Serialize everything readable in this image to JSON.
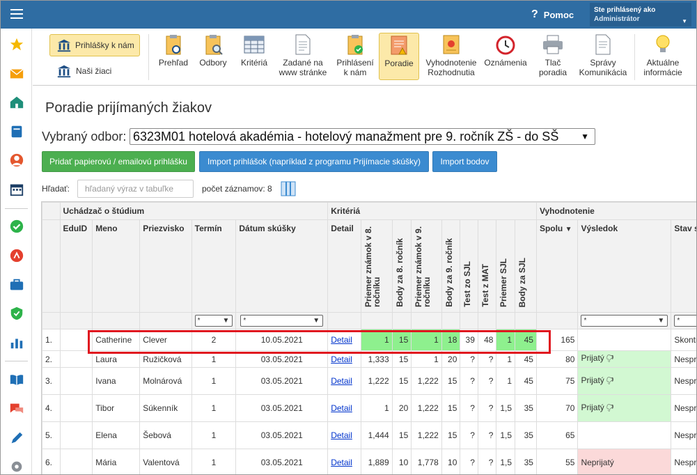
{
  "topbar": {
    "help_label": "Pomoc",
    "user_line1": "Ste prihlásený ako",
    "user_line2": "Administrátor"
  },
  "sidebar": {
    "icons": [
      "star-icon",
      "mail-icon",
      "home-icon",
      "book-icon",
      "user-target-icon",
      "calendar-icon",
      "check-circle-icon",
      "alert-icon",
      "briefcase-icon",
      "shield-check-icon",
      "bar-chart-icon",
      "open-book-icon",
      "chat-icon",
      "pencil-icon",
      "gear-icon"
    ]
  },
  "toolbar": {
    "prihlasky_label": "Prihlášky k nám",
    "ziaci_label": "Naši žiaci",
    "items": [
      {
        "l1": "Prehľad",
        "l2": ""
      },
      {
        "l1": "Odbory",
        "l2": ""
      },
      {
        "l1": "Kritériá",
        "l2": ""
      },
      {
        "l1": "Zadané na",
        "l2": "www stránke"
      },
      {
        "l1": "Prihlásení",
        "l2": "k nám"
      },
      {
        "l1": "Poradie",
        "l2": ""
      },
      {
        "l1": "Vyhodnotenie",
        "l2": "Rozhodnutia"
      },
      {
        "l1": "Oznámenia",
        "l2": ""
      },
      {
        "l1": "Tlač",
        "l2": "poradia"
      },
      {
        "l1": "Správy",
        "l2": "Komunikácia"
      },
      {
        "l1": "Aktuálne",
        "l2": "informácie"
      }
    ]
  },
  "page": {
    "title": "Poradie prijímaných žiakov",
    "field_label": "Vybraný odbor:",
    "field_value": "6323M01 hotelová akadémia - hotelový manažment pre 9. ročník ZŠ - do SŠ",
    "btn_paper": "Pridať papierovú / emailovú prihlášku",
    "btn_import": "Import prihlášok (napríklad z programu Prijímacie skúšky)",
    "btn_points": "Import bodov",
    "search_label": "Hľadať:",
    "search_placeholder": "hľadaný výraz v tabuľke",
    "count_label": "počet záznamov: 8"
  },
  "table": {
    "groups": {
      "applicant": "Uchádzač o štúdium",
      "criteria": "Kritériá",
      "evaluation": "Vyhodnotenie"
    },
    "headers": {
      "eduid": "EduID",
      "meno": "Meno",
      "priezvisko": "Priezvisko",
      "termin": "Termín",
      "datum": "Dátum skúšky",
      "detail": "Detail",
      "c1": "Priemer známok v 8. ročníku",
      "c2": "Body za 8. ročník",
      "c3": "Priemer známok v 9. ročníku",
      "c4": "Body za 9. ročník",
      "c5": "Test zo SJL",
      "c6": "Test z MAT",
      "c7": "Priemer SJL",
      "c8": "Body za SJL",
      "spolu": "Spolu",
      "sort": "▼",
      "vysledok": "Výsledok",
      "stav": "Stav spracova"
    },
    "filter": "*",
    "rows": [
      {
        "n": "1.",
        "meno": "Catherine",
        "priezvisko": "Clever",
        "termin": "2",
        "datum": "10.05.2021",
        "detail": "Detail",
        "c1": "1",
        "c2": "15",
        "c3": "1",
        "c4": "18",
        "c5": "39",
        "c6": "48",
        "c7": "1",
        "c8": "45",
        "spolu": "165",
        "vysledok": "",
        "stav": "Skontrolovaná"
      },
      {
        "n": "2.",
        "meno": "Laura",
        "priezvisko": "Ružičková",
        "termin": "1",
        "datum": "03.05.2021",
        "detail": "Detail",
        "c1": "1,333",
        "c2": "15",
        "c3": "1",
        "c4": "20",
        "c5": "?",
        "c6": "?",
        "c7": "1",
        "c8": "45",
        "spolu": "80",
        "vysledok": "Prijatý",
        "stav": "Nespracovaná"
      },
      {
        "n": "3.",
        "meno": "Ivana",
        "priezvisko": "Molnárová",
        "termin": "1",
        "datum": "03.05.2021",
        "detail": "Detail",
        "c1": "1,222",
        "c2": "15",
        "c3": "1,222",
        "c4": "15",
        "c5": "?",
        "c6": "?",
        "c7": "1",
        "c8": "45",
        "spolu": "75",
        "vysledok": "Prijatý",
        "stav": "Nespracovaná"
      },
      {
        "n": "4.",
        "meno": "Tibor",
        "priezvisko": "Súkenník",
        "termin": "1",
        "datum": "03.05.2021",
        "detail": "Detail",
        "c1": "1",
        "c2": "20",
        "c3": "1,222",
        "c4": "15",
        "c5": "?",
        "c6": "?",
        "c7": "1,5",
        "c8": "35",
        "spolu": "70",
        "vysledok": "Prijatý",
        "stav": "Nespracovaná"
      },
      {
        "n": "5.",
        "meno": "Elena",
        "priezvisko": "Šebová",
        "termin": "1",
        "datum": "03.05.2021",
        "detail": "Detail",
        "c1": "1,444",
        "c2": "15",
        "c3": "1,222",
        "c4": "15",
        "c5": "?",
        "c6": "?",
        "c7": "1,5",
        "c8": "35",
        "spolu": "65",
        "vysledok": "",
        "stav": "Nespracovaná"
      },
      {
        "n": "6.",
        "meno": "Mária",
        "priezvisko": "Valentová",
        "termin": "1",
        "datum": "03.05.2021",
        "detail": "Detail",
        "c1": "1,889",
        "c2": "10",
        "c3": "1,778",
        "c4": "10",
        "c5": "?",
        "c6": "?",
        "c7": "1,5",
        "c8": "35",
        "spolu": "55",
        "vysledok": "Neprijatý",
        "stav": "Nespracovaná"
      }
    ]
  },
  "colors": {
    "topbar": "#2f6da3",
    "highlight": "#fce9a9",
    "green_btn": "#4caf50",
    "blue_btn": "#3b8bd0",
    "green_cell": "#8ef08e",
    "accepted": "#d2f8d2",
    "rejected": "#fbd9d9",
    "red_box": "#e0161f"
  }
}
